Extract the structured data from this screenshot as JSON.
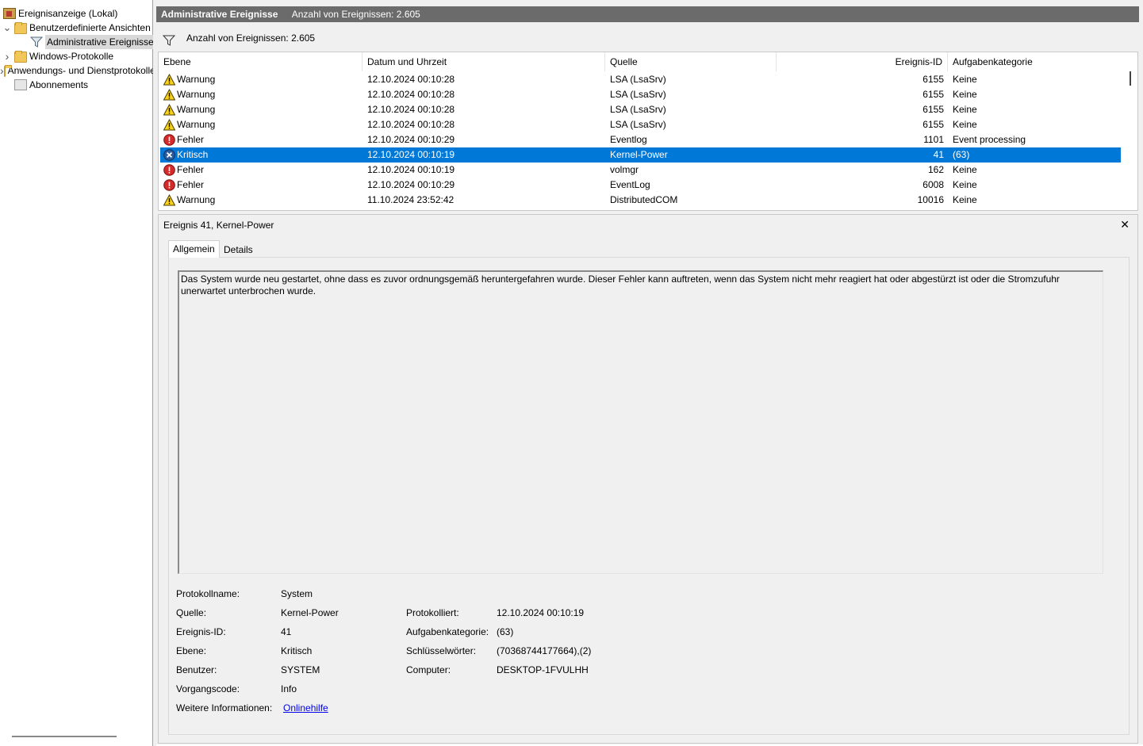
{
  "tree": {
    "items": [
      {
        "label": "Ereignisanzeige (Lokal)",
        "icon": "event-viewer-icon",
        "expander": ""
      },
      {
        "label": "Benutzerdefinierte Ansichten",
        "icon": "folder-icon",
        "expander": "⌄"
      },
      {
        "label": "Administrative Ereignisse",
        "icon": "filter-icon",
        "expander": ""
      },
      {
        "label": "Windows-Protokolle",
        "icon": "folder-icon",
        "expander": "›"
      },
      {
        "label": "Anwendungs- und Dienstprotokolle",
        "icon": "folder-icon",
        "expander": "›"
      },
      {
        "label": "Abonnements",
        "icon": "subscriptions-icon",
        "expander": ""
      }
    ]
  },
  "header": {
    "title": "Administrative Ereignisse",
    "count": "Anzahl von Ereignissen: 2.605",
    "background": "#6b6b6b"
  },
  "toolbar": {
    "count": "Anzahl von Ereignissen: 2.605"
  },
  "table": {
    "columns": [
      "Ebene",
      "Datum und Uhrzeit",
      "Quelle",
      "Ereignis-ID",
      "Aufgabenkategorie"
    ],
    "selected_color": "#0078d7",
    "rows": [
      {
        "level": "Warnung",
        "icon": "warning-icon",
        "date": "12.10.2024 00:10:28",
        "source": "LSA (LsaSrv)",
        "id": "6155",
        "category": "Keine"
      },
      {
        "level": "Warnung",
        "icon": "warning-icon",
        "date": "12.10.2024 00:10:28",
        "source": "LSA (LsaSrv)",
        "id": "6155",
        "category": "Keine"
      },
      {
        "level": "Warnung",
        "icon": "warning-icon",
        "date": "12.10.2024 00:10:28",
        "source": "LSA (LsaSrv)",
        "id": "6155",
        "category": "Keine"
      },
      {
        "level": "Warnung",
        "icon": "warning-icon",
        "date": "12.10.2024 00:10:28",
        "source": "LSA (LsaSrv)",
        "id": "6155",
        "category": "Keine"
      },
      {
        "level": "Fehler",
        "icon": "error-icon",
        "date": "12.10.2024 00:10:29",
        "source": "Eventlog",
        "id": "1101",
        "category": "Event processing"
      },
      {
        "level": "Kritisch",
        "icon": "critical-icon",
        "date": "12.10.2024 00:10:19",
        "source": "Kernel-Power",
        "id": "41",
        "category": "(63)",
        "selected": true
      },
      {
        "level": "Fehler",
        "icon": "error-icon",
        "date": "12.10.2024 00:10:19",
        "source": "volmgr",
        "id": "162",
        "category": "Keine"
      },
      {
        "level": "Fehler",
        "icon": "error-icon",
        "date": "12.10.2024 00:10:29",
        "source": "EventLog",
        "id": "6008",
        "category": "Keine"
      },
      {
        "level": "Warnung",
        "icon": "warning-icon",
        "date": "11.10.2024 23:52:42",
        "source": "DistributedCOM",
        "id": "10016",
        "category": "Keine"
      }
    ]
  },
  "detail": {
    "title": "Ereignis 41, Kernel-Power",
    "close": "✕",
    "tabs": [
      "Allgemein",
      "Details"
    ],
    "description": "Das System wurde neu gestartet, ohne dass es zuvor ordnungsgemäß heruntergefahren wurde. Dieser Fehler kann auftreten, wenn das System nicht mehr reagiert hat oder abgestürzt ist oder die Stromzufuhr unerwartet unterbrochen wurde.",
    "props": {
      "protokollname_label": "Protokollname:",
      "protokollname": "System",
      "quelle_label": "Quelle:",
      "quelle": "Kernel-Power",
      "ereignis_id_label": "Ereignis-ID:",
      "ereignis_id": "41",
      "ebene_label": "Ebene:",
      "ebene": "Kritisch",
      "benutzer_label": "Benutzer:",
      "benutzer": "SYSTEM",
      "vorgangscode_label": "Vorgangscode:",
      "vorgangscode": "Info",
      "weitere_label": "Weitere Informationen:",
      "weitere_link": "Onlinehilfe",
      "protokolliert_label": "Protokolliert:",
      "protokolliert": "12.10.2024 00:10:19",
      "aufgabenkategorie_label": "Aufgabenkategorie:",
      "aufgabenkategorie": "(63)",
      "schluesselwoerter_label": "Schlüsselwörter:",
      "schluesselwoerter": "(70368744177664),(2)",
      "computer_label": "Computer:",
      "computer": "DESKTOP-1FVULHH"
    }
  }
}
